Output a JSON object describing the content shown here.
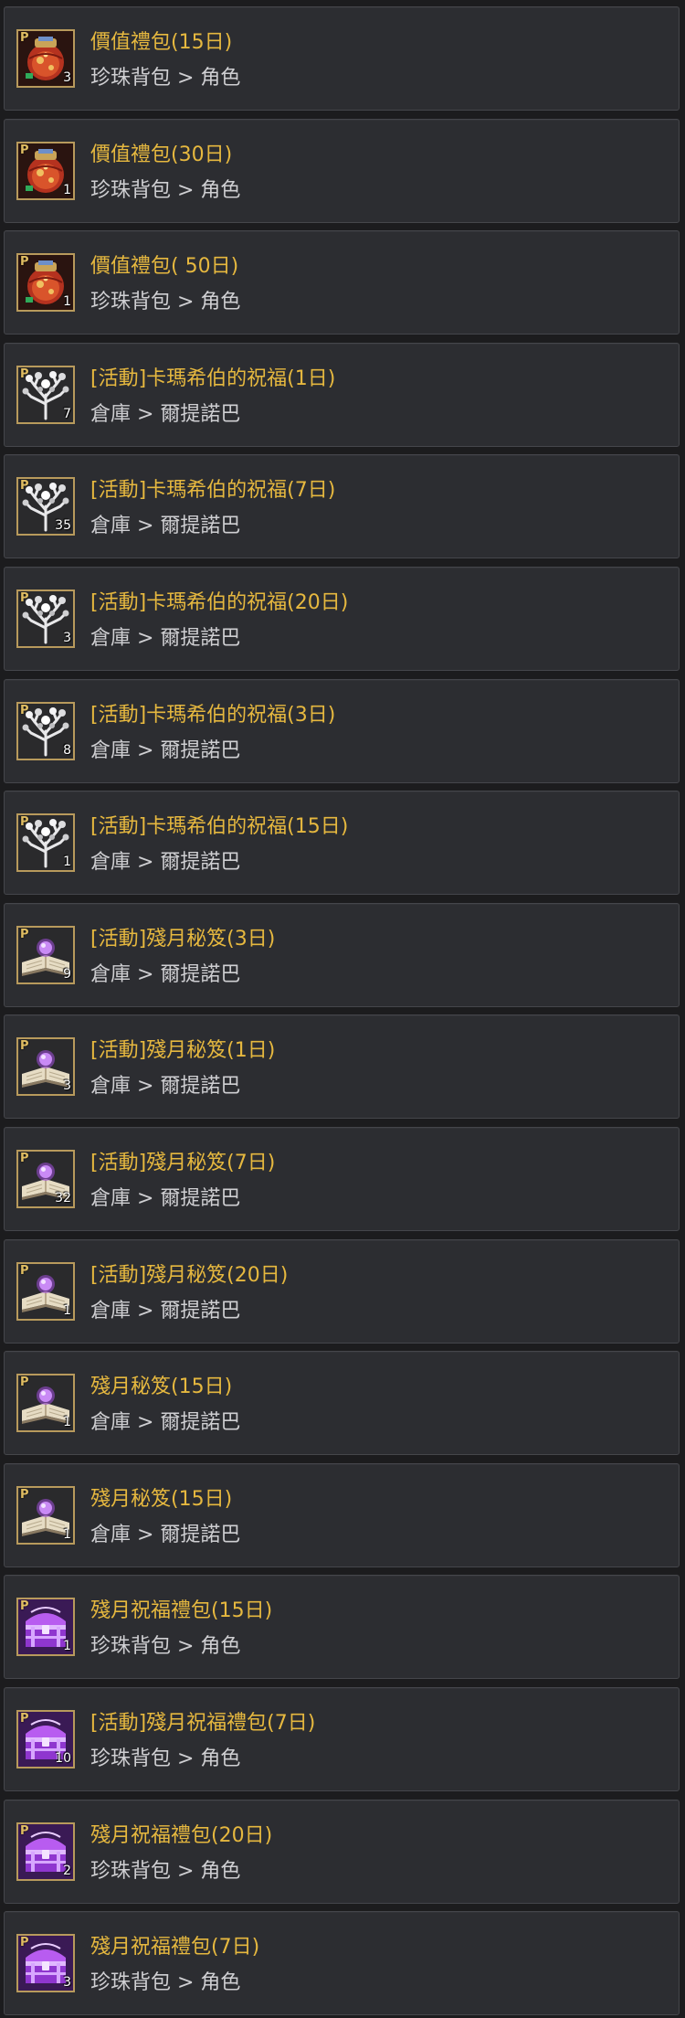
{
  "items": [
    {
      "name": "價值禮包(15日)",
      "location": "珍珠背包 > 角色",
      "quantity": "3",
      "icon": "gift-pouch-icon"
    },
    {
      "name": "價值禮包(30日)",
      "location": "珍珠背包 > 角色",
      "quantity": "1",
      "icon": "gift-pouch-icon"
    },
    {
      "name": "價值禮包( 50日)",
      "location": "珍珠背包 > 角色",
      "quantity": "1",
      "icon": "gift-pouch-icon"
    },
    {
      "name": "[活動]卡瑪希伯的祝福(1日)",
      "location": "倉庫 > 爾提諾巴",
      "quantity": "7",
      "icon": "blessing-tree-icon"
    },
    {
      "name": "[活動]卡瑪希伯的祝福(7日)",
      "location": "倉庫 > 爾提諾巴",
      "quantity": "35",
      "icon": "blessing-tree-icon"
    },
    {
      "name": "[活動]卡瑪希伯的祝福(20日)",
      "location": "倉庫 > 爾提諾巴",
      "quantity": "3",
      "icon": "blessing-tree-icon"
    },
    {
      "name": "[活動]卡瑪希伯的祝福(3日)",
      "location": "倉庫 > 爾提諾巴",
      "quantity": "8",
      "icon": "blessing-tree-icon"
    },
    {
      "name": "[活動]卡瑪希伯的祝福(15日)",
      "location": "倉庫 > 爾提諾巴",
      "quantity": "1",
      "icon": "blessing-tree-icon"
    },
    {
      "name": "[活動]殘月秘笈(3日)",
      "location": "倉庫 > 爾提諾巴",
      "quantity": "9",
      "icon": "secret-book-icon"
    },
    {
      "name": "[活動]殘月秘笈(1日)",
      "location": "倉庫 > 爾提諾巴",
      "quantity": "3",
      "icon": "secret-book-icon"
    },
    {
      "name": "[活動]殘月秘笈(7日)",
      "location": "倉庫 > 爾提諾巴",
      "quantity": "32",
      "icon": "secret-book-icon"
    },
    {
      "name": "[活動]殘月秘笈(20日)",
      "location": "倉庫 > 爾提諾巴",
      "quantity": "1",
      "icon": "secret-book-icon"
    },
    {
      "name": "殘月秘笈(15日)",
      "location": "倉庫 > 爾提諾巴",
      "quantity": "1",
      "icon": "secret-book-icon"
    },
    {
      "name": "殘月秘笈(15日)",
      "location": "倉庫 > 爾提諾巴",
      "quantity": "1",
      "icon": "secret-book-icon"
    },
    {
      "name": "殘月祝福禮包(15日)",
      "location": "珍珠背包 > 角色",
      "quantity": "1",
      "icon": "treasure-chest-icon"
    },
    {
      "name": "[活動]殘月祝福禮包(7日)",
      "location": "珍珠背包 > 角色",
      "quantity": "10",
      "icon": "treasure-chest-icon"
    },
    {
      "name": "殘月祝福禮包(20日)",
      "location": "珍珠背包 > 角色",
      "quantity": "2",
      "icon": "treasure-chest-icon"
    },
    {
      "name": "殘月祝福禮包(7日)",
      "location": "珍珠背包 > 角色",
      "quantity": "3",
      "icon": "treasure-chest-icon"
    }
  ],
  "pearl_marker": "P",
  "colors": {
    "item_name": "#e6b83f",
    "location": "#cfcfd2",
    "icon_border": "#b89a5c",
    "panel_bg": "#2c2d31"
  }
}
